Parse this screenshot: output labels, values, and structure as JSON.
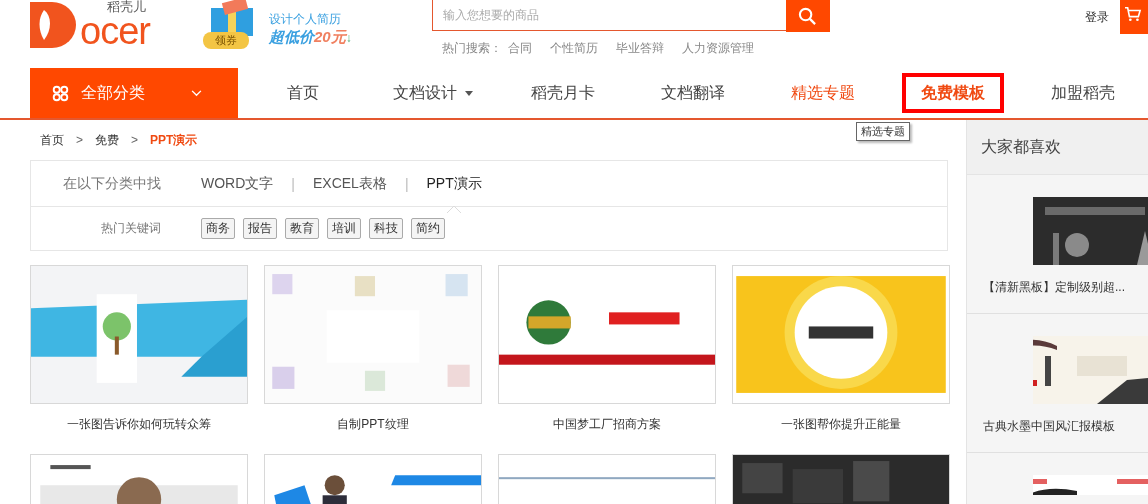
{
  "logo": {
    "brand_cn": "稻壳儿",
    "brand_text": "ocer"
  },
  "promo": {
    "badge": "领券",
    "line1": "设计个人简历",
    "price_label": "超低价",
    "price": "20元",
    "arrow": "↓"
  },
  "search": {
    "placeholder": "输入您想要的商品",
    "hot_label": "热门搜索：",
    "hot_terms": [
      "合同",
      "个性简历",
      "毕业答辩",
      "人力资源管理"
    ]
  },
  "login": "登录",
  "category_button": {
    "label": "全部分类"
  },
  "nav": [
    {
      "label": "首页",
      "selected": false,
      "featured": false,
      "dropdown": false
    },
    {
      "label": "文档设计",
      "selected": false,
      "featured": false,
      "dropdown": true
    },
    {
      "label": "稻壳月卡",
      "selected": false,
      "featured": false,
      "dropdown": false
    },
    {
      "label": "文档翻译",
      "selected": false,
      "featured": false,
      "dropdown": false
    },
    {
      "label": "精选专题",
      "selected": false,
      "featured": true,
      "dropdown": false
    },
    {
      "label": "免费模板",
      "selected": true,
      "featured": true,
      "dropdown": false
    },
    {
      "label": "加盟稻壳",
      "selected": false,
      "featured": false,
      "dropdown": false
    }
  ],
  "tooltip": "精选专题",
  "breadcrumb": [
    {
      "label": "首页",
      "current": false
    },
    {
      "label": "免费",
      "current": false
    },
    {
      "label": "PPT演示",
      "current": true
    }
  ],
  "breadcrumb_separator": ">",
  "filter": {
    "label": "在以下分类中找",
    "categories": [
      {
        "label": "WORD文字",
        "selected": false
      },
      {
        "label": "EXCEL表格",
        "selected": false
      },
      {
        "label": "PPT演示",
        "selected": true
      }
    ],
    "separator": "|",
    "keywords_label": "热门关键词",
    "keywords": [
      "商务",
      "报告",
      "教育",
      "培训",
      "科技",
      "简约"
    ]
  },
  "templates": [
    {
      "kind": "picture",
      "title": "一张图告诉你如何玩转众筹"
    },
    {
      "kind": "picture",
      "title": "自制PPT纹理"
    },
    {
      "kind": "picture",
      "title": "中国梦工厂招商方案"
    },
    {
      "kind": "picture",
      "title": "一张图帮你提升正能量"
    },
    {
      "kind": "picture"
    },
    {
      "kind": "picture"
    },
    {
      "kind": "picture"
    },
    {
      "kind": "picture"
    }
  ],
  "sidebar": {
    "title": "大家都喜欢",
    "items": [
      {
        "kind": "picture",
        "title": "【清新黑板】定制级别超..."
      },
      {
        "kind": "picture",
        "title": "古典水墨中国风汇报模板"
      },
      {
        "kind": "picture"
      }
    ]
  }
}
